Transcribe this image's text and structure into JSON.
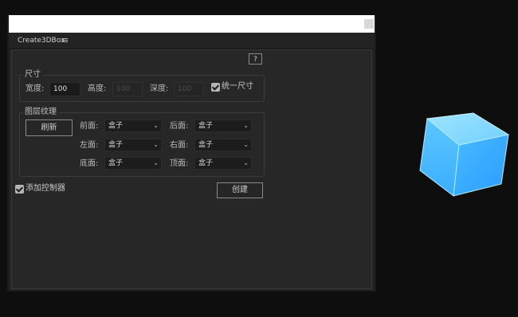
{
  "panel": {
    "tab_title": "Create3DBox",
    "help_label": "?"
  },
  "size": {
    "legend": "尺寸",
    "width_label": "宽度:",
    "width_value": "100",
    "height_label": "高度:",
    "height_value": "100",
    "depth_label": "深度:",
    "depth_value": "100",
    "uniform_label": "统一尺寸",
    "uniform_checked": true
  },
  "texture": {
    "legend": "图层纹理",
    "refresh_label": "刷新",
    "faces": [
      {
        "label": "前面:",
        "value": "盒子"
      },
      {
        "label": "后面:",
        "value": "盒子"
      },
      {
        "label": "左面:",
        "value": "盒子"
      },
      {
        "label": "右面:",
        "value": "盒子"
      },
      {
        "label": "底面:",
        "value": "盒子"
      },
      {
        "label": "顶面:",
        "value": "盒子"
      }
    ]
  },
  "controller": {
    "label": "添加控制器",
    "checked": true
  },
  "create_label": "创建",
  "colors": {
    "cube": "#3fb8ff",
    "panel_bg": "#232323",
    "canvas_bg": "#0e0e0e"
  }
}
